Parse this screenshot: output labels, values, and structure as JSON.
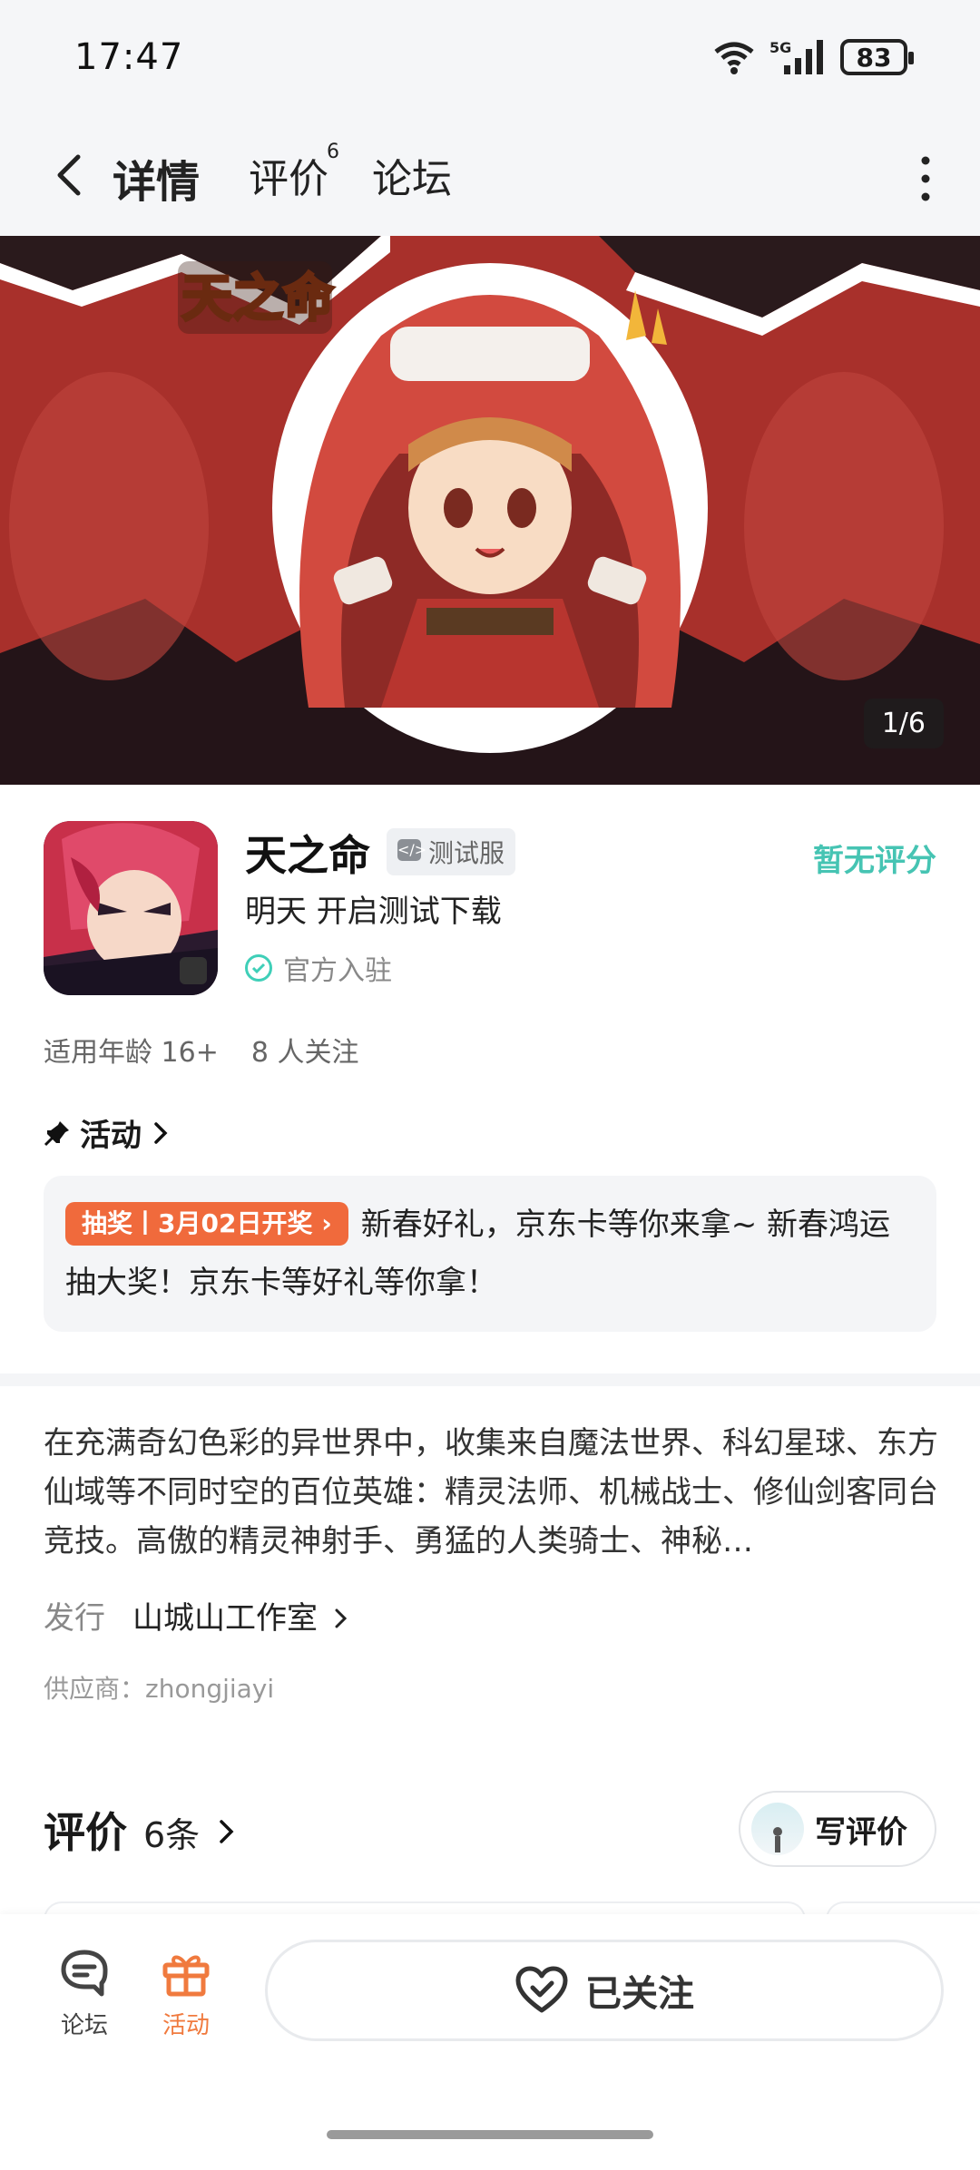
{
  "status": {
    "time": "17:47",
    "battery": "83"
  },
  "nav": {
    "tabs": [
      {
        "label": "详情"
      },
      {
        "label": "评价",
        "badge": "6"
      },
      {
        "label": "论坛"
      }
    ]
  },
  "banner": {
    "logo_text": "天之命",
    "counter": "1/6"
  },
  "app": {
    "title": "天之命",
    "test_badge": "测试服",
    "rating": "暂无评分",
    "subtitle": "明天 开启测试下载",
    "official": "官方入驻",
    "age": "适用年龄 16+",
    "followers": "8 人关注"
  },
  "activity": {
    "heading": "活动",
    "tag": "抽奖丨3月02日开奖",
    "text": "新春好礼，京东卡等你来拿~ 新春鸿运抽大奖！京东卡等好礼等你拿！"
  },
  "description": "在充满奇幻色彩的异世界中，收集来自魔法世界、科幻星球、东方仙域等不同时空的百位英雄：精灵法师、机械战士、修仙剑客同台竞技。高傲的精灵神射手、勇猛的人类骑士、神秘…",
  "publisher": {
    "label": "发行",
    "name": "山城山工作室"
  },
  "supplier": "供应商：zhongjiayi",
  "reviews": {
    "title": "评价",
    "count": "6条",
    "write_label": "写评价"
  },
  "bottom": {
    "forum_label": "论坛",
    "activity_label": "活动",
    "follow_label": "已关注"
  },
  "colors": {
    "accent": "#3fd0b8",
    "orange": "#f06a3c",
    "banner_red": "#a8302b"
  }
}
